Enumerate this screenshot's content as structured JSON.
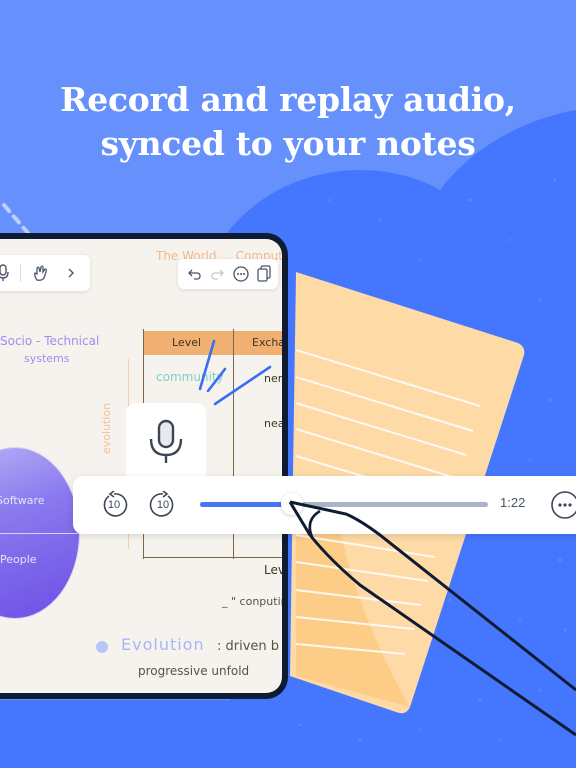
{
  "headline": {
    "line1": "Record and replay audio,",
    "line2": "synced to your notes"
  },
  "colors": {
    "background": "#6690fb",
    "blob": "#4477fe",
    "paper": "#fddaa6",
    "accent": "#4a73f5",
    "frame": "#0f1a33"
  },
  "toolbar_left": {
    "icons": [
      "microphone-icon",
      "hand-pointer-icon",
      "chevron-right-icon"
    ]
  },
  "toolbar_right": {
    "icons": [
      "undo-icon",
      "redo-icon",
      "more-icon",
      "copy-pages-icon"
    ]
  },
  "notes": {
    "title_partial": "The World ... Comput",
    "socio_line1": "Socio - Technical",
    "socio_line2": "systems",
    "table_header_1": "Level",
    "table_header_2": "Excha",
    "row1_col1": "community",
    "row1_col2": "nen",
    "row2_col2": "nea",
    "evolution_vertical": "evolution",
    "sphere_top": "Software",
    "sphere_bottom": "People",
    "level_label": "Lev",
    "computing": "_ \" conputin",
    "evolution_heading": "Evolution",
    "evolution_text": ": driven b",
    "progressive": "progressive  unfold"
  },
  "record": {
    "icon": "microphone-icon"
  },
  "player": {
    "rewind_label": "10",
    "forward_label": "10",
    "progress_fraction": 0.32,
    "time": "1:22",
    "more_icon": "more-icon"
  }
}
